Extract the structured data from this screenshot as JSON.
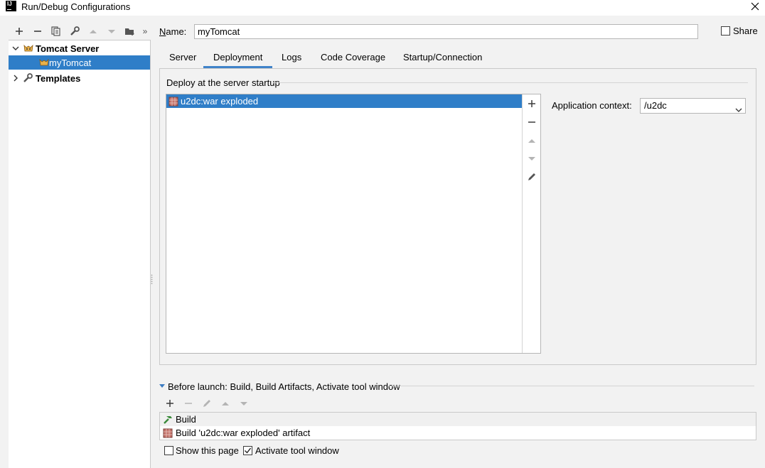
{
  "window": {
    "title": "Run/Debug Configurations",
    "logo_text": "IJ",
    "close_icon": "close-icon"
  },
  "left_toolbar": {
    "icons": [
      "add-icon",
      "remove-icon",
      "copy-icon",
      "wrench-icon",
      "move-up-icon",
      "move-down-icon",
      "folder-icon",
      "more-icon"
    ],
    "more_glyph": "»"
  },
  "tree": {
    "tomcat_server": "Tomcat Server",
    "my_tomcat": "myTomcat",
    "templates": "Templates"
  },
  "name_field": {
    "label": "Name:",
    "value": "myTomcat"
  },
  "share": {
    "label": "Share",
    "checked": false
  },
  "tabs": [
    {
      "label": "Server",
      "active": false
    },
    {
      "label": "Deployment",
      "active": true
    },
    {
      "label": "Logs",
      "active": false
    },
    {
      "label": "Code Coverage",
      "active": false
    },
    {
      "label": "Startup/Connection",
      "active": false
    }
  ],
  "deployment": {
    "section_title": "Deploy at the server startup",
    "artifacts": [
      "u2dc:war exploded"
    ],
    "side_icons": [
      "add-icon",
      "remove-icon",
      "move-up-icon",
      "move-down-icon",
      "edit-icon"
    ],
    "context_label": "Application context:",
    "context_value": "/u2dc"
  },
  "before_launch": {
    "title": "Before launch: Build, Build Artifacts, Activate tool window",
    "toolbar_icons": [
      "add-icon",
      "remove-icon",
      "edit-icon",
      "move-up-icon",
      "move-down-icon"
    ],
    "items": [
      "Build",
      "Build 'u2dc:war exploded' artifact"
    ]
  },
  "options": {
    "show_page_label": "Show this page",
    "show_page_checked": false,
    "activate_label": "Activate tool window",
    "activate_checked": true
  },
  "colors": {
    "selection": "#2f7ec8",
    "tab_underline": "#4083c9",
    "background": "#f2f2f2"
  }
}
